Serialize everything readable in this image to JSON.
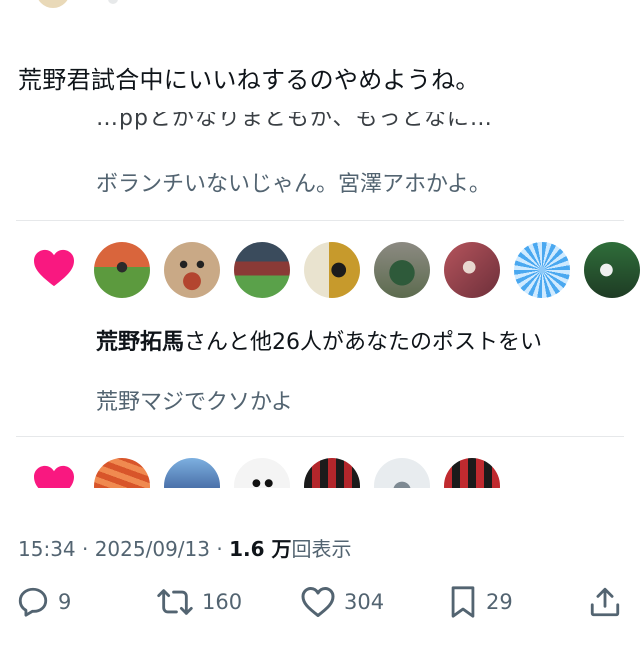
{
  "tweet": {
    "text": "荒野君試合中にいいねするのやめようね。",
    "timestamp": "15:34 · 2025/09/13 · ",
    "views_count": "1.6 万",
    "views_label": "回表示"
  },
  "embedded_image": {
    "cut_off_text": "…ppとかなりまともか、もっとなに…",
    "reply_1": "ボランチいないじゃん。宮澤アホかよ。",
    "like_1": {
      "name": "荒野拓馬",
      "text": "さんと他26人があなたのポストをい"
    },
    "reply_2": "荒野マジでクソかよ"
  },
  "actions": {
    "replies": "9",
    "reposts": "160",
    "likes": "304",
    "bookmarks": "29"
  },
  "colors": {
    "heart": "#f91880",
    "text": "#0f1419",
    "muted": "#536471"
  }
}
